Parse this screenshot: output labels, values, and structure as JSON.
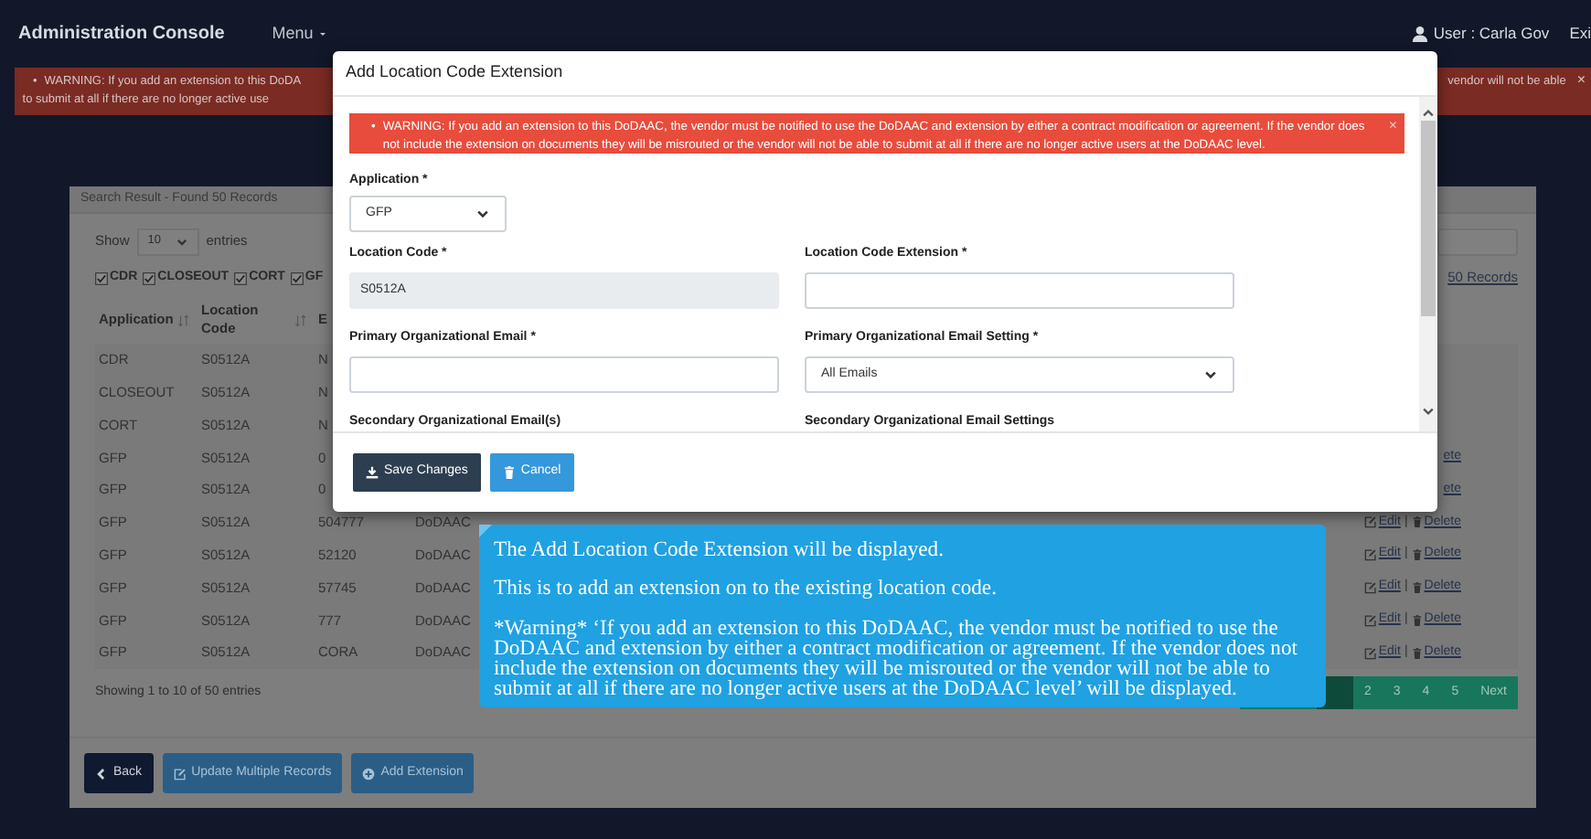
{
  "header": {
    "title": "Administration Console",
    "menu": "Menu",
    "user": "User : Carla Gov",
    "exit": "Exi"
  },
  "background_warning": {
    "bullet": "•",
    "line_1": "WARNING: If you add an extension to this DoDA",
    "line_2": "to submit at all if there are no longer active use",
    "right_text": "vendor will not be able",
    "close": "×"
  },
  "panel": {
    "title": "Search Result - Found 50 Records",
    "show_label": "Show",
    "page_size": "10",
    "entries_label": "entries",
    "show_all_link": "50 Records",
    "filters": [
      {
        "label": "CDR",
        "checked": true
      },
      {
        "label": "CLOSEOUT",
        "checked": true
      },
      {
        "label": "CORT",
        "checked": true
      },
      {
        "label": "GF",
        "checked": true
      }
    ],
    "columns": [
      "Application",
      "Location Code",
      "E"
    ],
    "rows": [
      {
        "application": "CDR",
        "location_code": "S0512A",
        "column_3": "N"
      },
      {
        "application": "CLOSEOUT",
        "location_code": "S0512A",
        "column_3": "N"
      },
      {
        "application": "CORT",
        "location_code": "S0512A",
        "column_3": "N"
      },
      {
        "application": "GFP",
        "location_code": "S0512A",
        "column_3": "0",
        "delete": "ete"
      },
      {
        "application": "GFP",
        "location_code": "S0512A",
        "column_3": "0",
        "delete": "ete"
      },
      {
        "application": "GFP",
        "location_code": "S0512A",
        "column_3": "504777",
        "type": "DoDAAC",
        "edit": "Edit",
        "separator": "|",
        "delete": "Delete"
      },
      {
        "application": "GFP",
        "location_code": "S0512A",
        "column_3": "52120",
        "type": "DoDAAC",
        "edit": "Edit",
        "separator": "|",
        "delete": "Delete"
      },
      {
        "application": "GFP",
        "location_code": "S0512A",
        "column_3": "57745",
        "type": "DoDAAC",
        "edit": "Edit",
        "separator": "|",
        "delete": "Delete"
      },
      {
        "application": "GFP",
        "location_code": "S0512A",
        "column_3": "777",
        "type": "DoDAAC",
        "edit": "Edit",
        "separator": "|",
        "delete": "Delete"
      },
      {
        "application": "GFP",
        "location_code": "S0512A",
        "column_3": "CORA",
        "type": "DoDAAC",
        "edit": "Edit",
        "separator": "|",
        "delete": "Delete"
      }
    ],
    "info": "Showing 1 to 10 of 50 entries",
    "covered_pages": [
      {
        "selected": false
      },
      {
        "selected": true
      }
    ],
    "pages": [
      {
        "label": "2",
        "selected": false
      },
      {
        "label": "3",
        "selected": false
      },
      {
        "label": "4",
        "selected": false
      },
      {
        "label": "5",
        "selected": false
      },
      {
        "label": "Next",
        "selected": false
      }
    ],
    "buttons": [
      {
        "label": "Back",
        "kind": "back"
      },
      {
        "label": "Update Multiple Records",
        "kind": "update"
      },
      {
        "label": "Add Extension",
        "kind": "add"
      }
    ]
  },
  "modal": {
    "title": "Add Location Code Extension",
    "warning": {
      "bullet": "•",
      "text": "WARNING: If you add an extension to this DoDAAC, the vendor must be notified to use the DoDAAC and extension by either a contract modification or agreement. If the vendor does not include the extension on documents they will be misrouted or the vendor will not be able to submit at all if there are no longer active users at the DoDAAC level.",
      "close": "×"
    },
    "fields": [
      {
        "label": "Application *",
        "kind": "select",
        "value": "GFP"
      },
      {
        "label": "Location Code *",
        "kind": "readonly",
        "value": "S0512A"
      },
      {
        "label": "Location Code Extension *",
        "kind": "text"
      },
      {
        "label": "Primary Organizational Email *",
        "kind": "text"
      },
      {
        "label": "Primary Organizational Email Setting *",
        "kind": "select",
        "value": "All Emails"
      },
      {
        "label": "Secondary Organizational Email(s)",
        "kind": "label"
      },
      {
        "label": "Secondary Organizational Email Settings",
        "kind": "label"
      }
    ],
    "buttons": [
      {
        "label": "Save Changes",
        "kind": "save"
      },
      {
        "label": "Cancel",
        "kind": "cancel"
      }
    ]
  },
  "tooltip": {
    "paragraphs": [
      "The Add Location Code Extension will be displayed.",
      "This is to add an extension on to the existing location code.",
      "*Warning* ‘If you add an extension to this DoDAAC, the vendor must be notified to use the DoDAAC and extension by either a contract modification or agreement. If the vendor does not include the extension on documents they will be misrouted or the vendor will not be able to submit at all if there are no longer active users at the DoDAAC level’ will be displayed."
    ]
  }
}
